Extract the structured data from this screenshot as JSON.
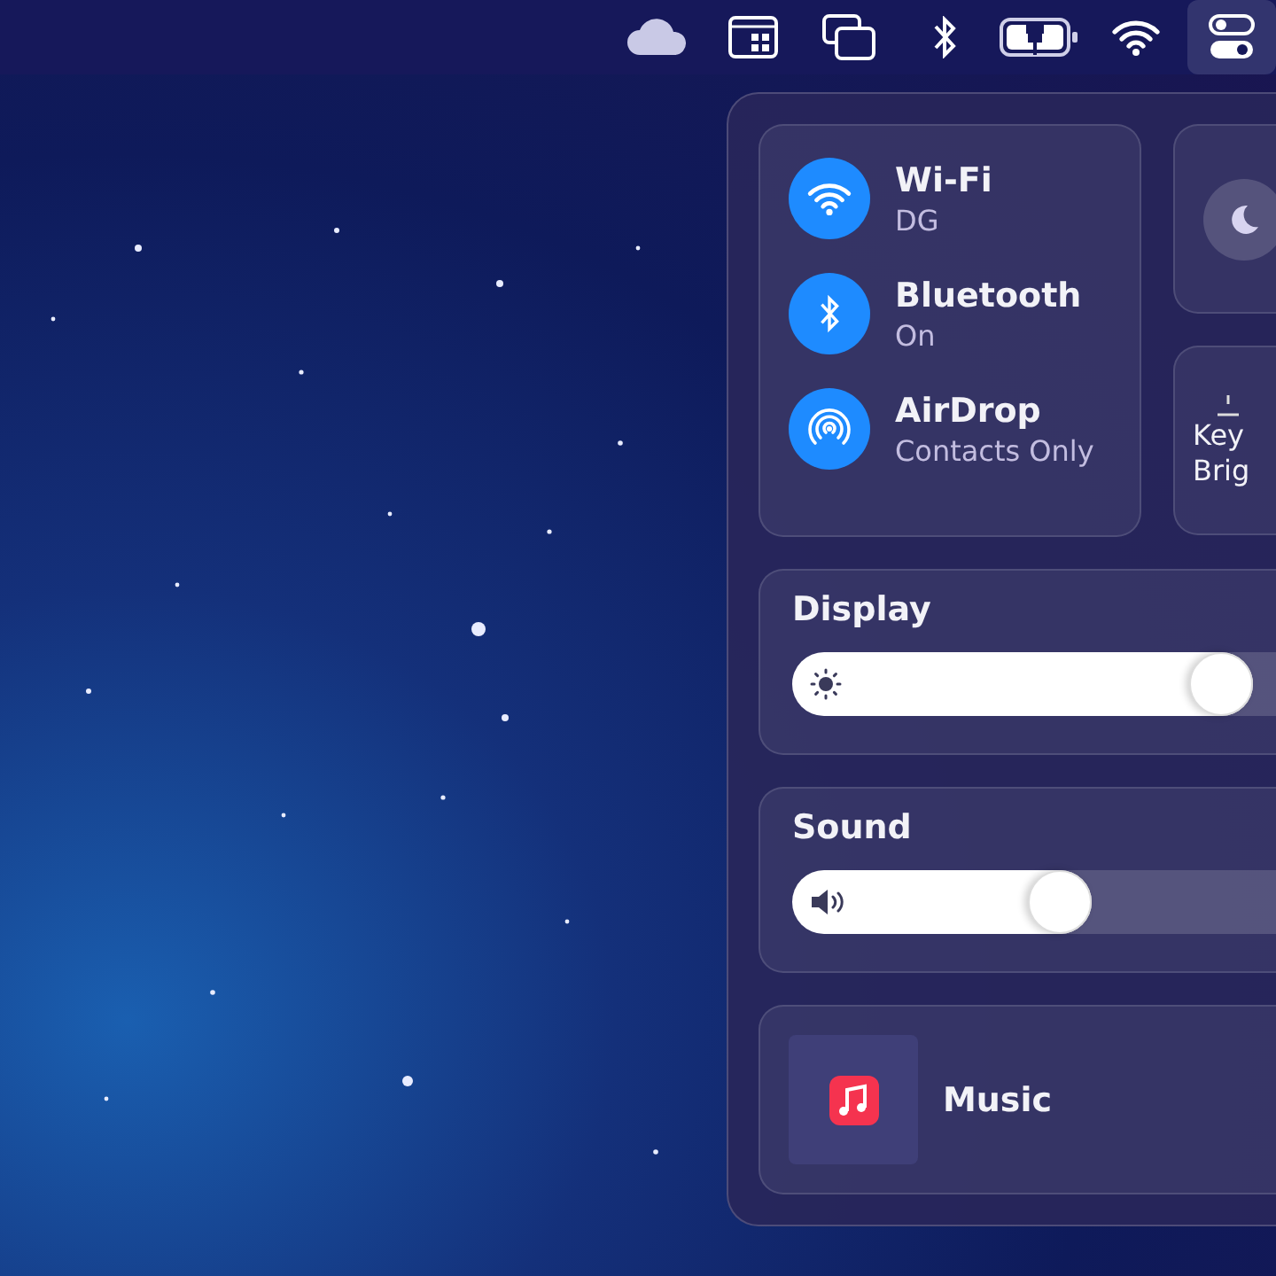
{
  "menu_bar": {
    "items": [
      {
        "kind": "cloud",
        "selected": false
      },
      {
        "kind": "app-grid",
        "selected": false
      },
      {
        "kind": "windows",
        "selected": false
      },
      {
        "kind": "bluetooth",
        "selected": false
      },
      {
        "kind": "battery",
        "selected": false
      },
      {
        "kind": "wifi",
        "selected": false
      },
      {
        "kind": "toggles",
        "selected": true
      }
    ]
  },
  "control_center": {
    "connectivity": [
      {
        "kind": "wifi",
        "title": "Wi-Fi",
        "subtitle": "DG",
        "on": true
      },
      {
        "kind": "bluetooth",
        "title": "Bluetooth",
        "subtitle": "On",
        "on": true
      },
      {
        "kind": "airdrop",
        "title": "AirDrop",
        "subtitle": "Contacts Only",
        "on": true
      }
    ],
    "focus": {
      "on": false
    },
    "keyboard_brightness": {
      "label_lines": [
        "Key",
        "Brig"
      ]
    },
    "sliders": [
      {
        "kind": "display",
        "title": "Display",
        "level": 0.885
      },
      {
        "kind": "sound",
        "title": "Sound",
        "level": 0.575
      }
    ],
    "now_playing": {
      "title": "Music"
    }
  }
}
